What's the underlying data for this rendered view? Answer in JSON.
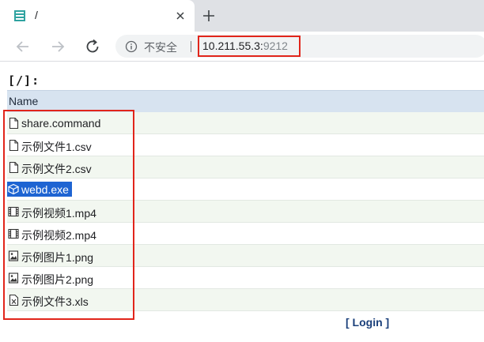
{
  "browser": {
    "tab_title": "/",
    "security_label": "不安全",
    "url_host": "10.211.55.3:",
    "url_port": "9212"
  },
  "page": {
    "path_title": "[/]:",
    "column_header": "Name",
    "files": [
      {
        "name": "share.command",
        "icon": "document-icon"
      },
      {
        "name": "示例文件1.csv",
        "icon": "document-icon"
      },
      {
        "name": "示例文件2.csv",
        "icon": "document-icon"
      },
      {
        "name": "webd.exe",
        "icon": "executable-icon",
        "selected": true
      },
      {
        "name": "示例视频1.mp4",
        "icon": "video-icon"
      },
      {
        "name": "示例视频2.mp4",
        "icon": "video-icon"
      },
      {
        "name": "示例图片1.png",
        "icon": "image-icon"
      },
      {
        "name": "示例图片2.png",
        "icon": "image-icon"
      },
      {
        "name": "示例文件3.xls",
        "icon": "spreadsheet-icon"
      }
    ],
    "login_label": "[ Login ]"
  },
  "colors": {
    "highlight": "#e1251b",
    "selection": "#1e64d2",
    "header_bg": "#d7e3f0",
    "row_alt_bg": "#f2f7f0"
  }
}
